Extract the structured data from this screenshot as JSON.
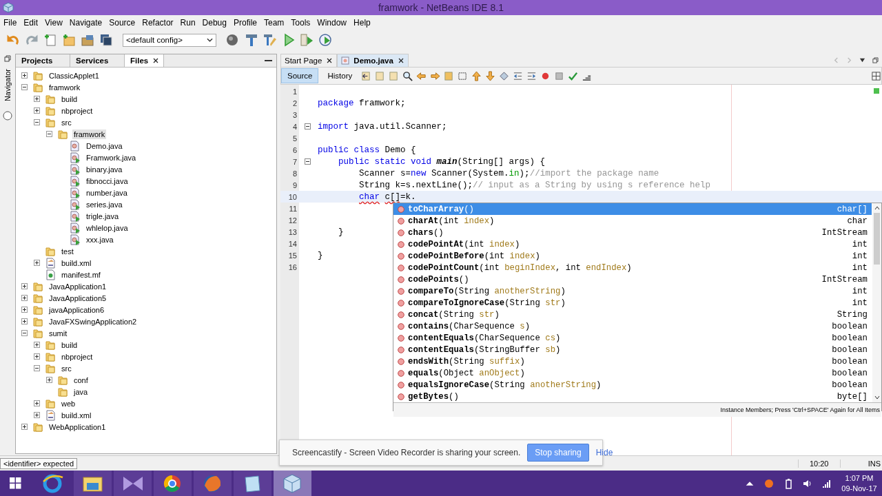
{
  "window": {
    "title": "framwork - NetBeans IDE 8.1"
  },
  "menu": [
    "File",
    "Edit",
    "View",
    "Navigate",
    "Source",
    "Refactor",
    "Run",
    "Debug",
    "Profile",
    "Team",
    "Tools",
    "Window",
    "Help"
  ],
  "toolbar": {
    "config": "<default config>"
  },
  "navigator": {
    "label": "Navigator"
  },
  "left_tabs": [
    {
      "label": "Projects",
      "selected": false,
      "closable": false
    },
    {
      "label": "Services",
      "selected": false,
      "closable": false
    },
    {
      "label": "Files",
      "selected": true,
      "closable": true
    }
  ],
  "tree": [
    {
      "label": "ClassicApplet1",
      "kind": "folder",
      "expanded": false,
      "selected": false
    },
    {
      "label": "framwork",
      "kind": "folder",
      "expanded": true,
      "selected": false,
      "children": [
        {
          "label": "build",
          "kind": "folder",
          "expanded": false,
          "selected": false
        },
        {
          "label": "nbproject",
          "kind": "folder",
          "expanded": false,
          "selected": false
        },
        {
          "label": "src",
          "kind": "folder",
          "expanded": true,
          "selected": false,
          "children": [
            {
              "label": "framwork",
              "kind": "folder",
              "expanded": true,
              "selected": true,
              "children": [
                {
                  "label": "Demo.java",
                  "kind": "java",
                  "selected": false
                },
                {
                  "label": "Framwork.java",
                  "kind": "java-run",
                  "selected": false
                },
                {
                  "label": "binary.java",
                  "kind": "java-run",
                  "selected": false
                },
                {
                  "label": "fibnocci.java",
                  "kind": "java-run",
                  "selected": false
                },
                {
                  "label": "number.java",
                  "kind": "java-run",
                  "selected": false
                },
                {
                  "label": "series.java",
                  "kind": "java-run",
                  "selected": false
                },
                {
                  "label": "trigle.java",
                  "kind": "java-run",
                  "selected": false
                },
                {
                  "label": "whlelop.java",
                  "kind": "java-run",
                  "selected": false
                },
                {
                  "label": "xxx.java",
                  "kind": "java-run",
                  "selected": false
                }
              ]
            }
          ]
        },
        {
          "label": "test",
          "kind": "folder",
          "selected": false
        },
        {
          "label": "build.xml",
          "kind": "xml",
          "expanded": false,
          "selected": false
        },
        {
          "label": "manifest.mf",
          "kind": "manifest",
          "selected": false
        }
      ]
    },
    {
      "label": "JavaApplication1",
      "kind": "folder",
      "expanded": false,
      "selected": false
    },
    {
      "label": "JavaApplication5",
      "kind": "folder",
      "expanded": false,
      "selected": false
    },
    {
      "label": "javaApplication6",
      "kind": "folder",
      "expanded": false,
      "selected": false
    },
    {
      "label": "JavaFXSwingApplication2",
      "kind": "folder",
      "expanded": false,
      "selected": false
    },
    {
      "label": "sumit",
      "kind": "folder",
      "expanded": true,
      "selected": false,
      "children": [
        {
          "label": "build",
          "kind": "folder",
          "expanded": false,
          "selected": false
        },
        {
          "label": "nbproject",
          "kind": "folder",
          "expanded": false,
          "selected": false
        },
        {
          "label": "src",
          "kind": "folder",
          "expanded": true,
          "selected": false,
          "children": [
            {
              "label": "conf",
              "kind": "folder",
              "expanded": false,
              "selected": false
            },
            {
              "label": "java",
              "kind": "folder",
              "selected": false
            }
          ]
        },
        {
          "label": "web",
          "kind": "folder",
          "expanded": false,
          "selected": false
        },
        {
          "label": "build.xml",
          "kind": "xml",
          "expanded": false,
          "selected": false
        }
      ]
    },
    {
      "label": "WebApplication1",
      "kind": "folder",
      "expanded": false,
      "selected": false
    }
  ],
  "editor_tabs": [
    {
      "label": "Start Page",
      "selected": false
    },
    {
      "label": "Demo.java",
      "selected": true
    }
  ],
  "view_tabs": [
    {
      "label": "Source",
      "selected": true
    },
    {
      "label": "History",
      "selected": false
    }
  ],
  "code": [
    {
      "n": "1",
      "fold": false,
      "current": false
    },
    {
      "n": "2",
      "fold": false,
      "current": false,
      "tokens": [
        {
          "t": "package",
          "kind": "kw"
        },
        {
          "t": " framwork;",
          "kind": "plain"
        }
      ]
    },
    {
      "n": "3",
      "fold": false,
      "current": false
    },
    {
      "n": "4",
      "fold": true,
      "current": false,
      "tokens": [
        {
          "t": "import",
          "kind": "kw"
        },
        {
          "t": " java.util.Scanner;",
          "kind": "plain"
        }
      ]
    },
    {
      "n": "5",
      "fold": false,
      "current": false
    },
    {
      "n": "6",
      "fold": false,
      "current": false,
      "tokens": [
        {
          "t": "public class",
          "kind": "kw"
        },
        {
          "t": " Demo {",
          "kind": "plain"
        }
      ]
    },
    {
      "n": "7",
      "fold": true,
      "current": false,
      "tokens": [
        {
          "t": "    public static void ",
          "kind": "kw"
        },
        {
          "t": "main",
          "kind": "method"
        },
        {
          "t": "(String[] args) {",
          "kind": "plain"
        }
      ]
    },
    {
      "n": "8",
      "fold": false,
      "current": false,
      "tokens": [
        {
          "t": "        Scanner s=",
          "kind": "plain"
        },
        {
          "t": "new",
          "kind": "kw"
        },
        {
          "t": " Scanner(System.",
          "kind": "plain"
        },
        {
          "t": "in",
          "kind": "field"
        },
        {
          "t": ");",
          "kind": "plain"
        },
        {
          "t": "//import the package name",
          "kind": "comment"
        }
      ]
    },
    {
      "n": "9",
      "fold": false,
      "current": false,
      "tokens": [
        {
          "t": "        String k=s.nextLine();",
          "kind": "plain"
        },
        {
          "t": "// input as a String by using s reference help",
          "kind": "comment"
        }
      ]
    },
    {
      "n": "10",
      "fold": false,
      "current": true,
      "tokens": [
        {
          "t": "        char",
          "kind": "kw",
          "squiggle": true
        },
        {
          "t": " c[]",
          "kind": "plain",
          "squiggle": true
        },
        {
          "t": "=k.",
          "kind": "plain",
          "squiggle": false
        }
      ]
    },
    {
      "n": "11",
      "fold": false,
      "current": false
    },
    {
      "n": "12",
      "fold": false,
      "current": false
    },
    {
      "n": "13",
      "fold": false,
      "current": false,
      "tokens": [
        {
          "t": "    }",
          "kind": "plain"
        }
      ]
    },
    {
      "n": "14",
      "fold": false,
      "current": false
    },
    {
      "n": "15",
      "fold": false,
      "current": false,
      "tokens": [
        {
          "t": "}",
          "kind": "plain"
        }
      ]
    },
    {
      "n": "16",
      "fold": false,
      "current": false
    }
  ],
  "completion": {
    "items": [
      {
        "selected": true,
        "returns": "char[]",
        "sig": [
          {
            "t": "toCharArray",
            "kind": "name"
          },
          {
            "t": "()",
            "kind": "plain"
          }
        ]
      },
      {
        "selected": false,
        "returns": "char",
        "sig": [
          {
            "t": "charAt",
            "kind": "name"
          },
          {
            "t": "(int ",
            "kind": "plain"
          },
          {
            "t": "index",
            "kind": "param"
          },
          {
            "t": ")",
            "kind": "plain"
          }
        ]
      },
      {
        "selected": false,
        "returns": "IntStream",
        "sig": [
          {
            "t": "chars",
            "kind": "name"
          },
          {
            "t": "()",
            "kind": "plain"
          }
        ]
      },
      {
        "selected": false,
        "returns": "int",
        "sig": [
          {
            "t": "codePointAt",
            "kind": "name"
          },
          {
            "t": "(int ",
            "kind": "plain"
          },
          {
            "t": "index",
            "kind": "param"
          },
          {
            "t": ")",
            "kind": "plain"
          }
        ]
      },
      {
        "selected": false,
        "returns": "int",
        "sig": [
          {
            "t": "codePointBefore",
            "kind": "name"
          },
          {
            "t": "(int ",
            "kind": "plain"
          },
          {
            "t": "index",
            "kind": "param"
          },
          {
            "t": ")",
            "kind": "plain"
          }
        ]
      },
      {
        "selected": false,
        "returns": "int",
        "sig": [
          {
            "t": "codePointCount",
            "kind": "name"
          },
          {
            "t": "(int ",
            "kind": "plain"
          },
          {
            "t": "beginIndex",
            "kind": "param"
          },
          {
            "t": ", int ",
            "kind": "plain"
          },
          {
            "t": "endIndex",
            "kind": "param"
          },
          {
            "t": ")",
            "kind": "plain"
          }
        ]
      },
      {
        "selected": false,
        "returns": "IntStream",
        "sig": [
          {
            "t": "codePoints",
            "kind": "name"
          },
          {
            "t": "()",
            "kind": "plain"
          }
        ]
      },
      {
        "selected": false,
        "returns": "int",
        "sig": [
          {
            "t": "compareTo",
            "kind": "name"
          },
          {
            "t": "(String ",
            "kind": "plain"
          },
          {
            "t": "anotherString",
            "kind": "param"
          },
          {
            "t": ")",
            "kind": "plain"
          }
        ]
      },
      {
        "selected": false,
        "returns": "int",
        "sig": [
          {
            "t": "compareToIgnoreCase",
            "kind": "name"
          },
          {
            "t": "(String ",
            "kind": "plain"
          },
          {
            "t": "str",
            "kind": "param"
          },
          {
            "t": ")",
            "kind": "plain"
          }
        ]
      },
      {
        "selected": false,
        "returns": "String",
        "sig": [
          {
            "t": "concat",
            "kind": "name"
          },
          {
            "t": "(String ",
            "kind": "plain"
          },
          {
            "t": "str",
            "kind": "param"
          },
          {
            "t": ")",
            "kind": "plain"
          }
        ]
      },
      {
        "selected": false,
        "returns": "boolean",
        "sig": [
          {
            "t": "contains",
            "kind": "name"
          },
          {
            "t": "(CharSequence ",
            "kind": "plain"
          },
          {
            "t": "s",
            "kind": "param"
          },
          {
            "t": ")",
            "kind": "plain"
          }
        ]
      },
      {
        "selected": false,
        "returns": "boolean",
        "sig": [
          {
            "t": "contentEquals",
            "kind": "name"
          },
          {
            "t": "(CharSequence ",
            "kind": "plain"
          },
          {
            "t": "cs",
            "kind": "param"
          },
          {
            "t": ")",
            "kind": "plain"
          }
        ]
      },
      {
        "selected": false,
        "returns": "boolean",
        "sig": [
          {
            "t": "contentEquals",
            "kind": "name"
          },
          {
            "t": "(StringBuffer ",
            "kind": "plain"
          },
          {
            "t": "sb",
            "kind": "param"
          },
          {
            "t": ")",
            "kind": "plain"
          }
        ]
      },
      {
        "selected": false,
        "returns": "boolean",
        "sig": [
          {
            "t": "endsWith",
            "kind": "name"
          },
          {
            "t": "(String ",
            "kind": "plain"
          },
          {
            "t": "suffix",
            "kind": "param"
          },
          {
            "t": ")",
            "kind": "plain"
          }
        ]
      },
      {
        "selected": false,
        "returns": "boolean",
        "sig": [
          {
            "t": "equals",
            "kind": "name"
          },
          {
            "t": "(Object ",
            "kind": "plain"
          },
          {
            "t": "anObject",
            "kind": "param"
          },
          {
            "t": ")",
            "kind": "plain"
          }
        ]
      },
      {
        "selected": false,
        "returns": "boolean",
        "sig": [
          {
            "t": "equalsIgnoreCase",
            "kind": "name"
          },
          {
            "t": "(String ",
            "kind": "plain"
          },
          {
            "t": "anotherString",
            "kind": "param"
          },
          {
            "t": ")",
            "kind": "plain"
          }
        ]
      },
      {
        "selected": false,
        "returns": "byte[]",
        "sig": [
          {
            "t": "getBytes",
            "kind": "name"
          },
          {
            "t": "()",
            "kind": "plain"
          }
        ]
      }
    ],
    "footer": "Instance Members; Press 'Ctrl+SPACE' Again for All Items"
  },
  "status_bar": {
    "message": "<identifier> expected",
    "position": "10:20",
    "mode": "INS"
  },
  "share_bar": {
    "text": "Screencastify - Screen Video Recorder is sharing your screen.",
    "stop": "Stop sharing",
    "hide": "Hide"
  },
  "taskbar": {
    "time": "1:07 PM",
    "date": "09-Nov-17"
  }
}
